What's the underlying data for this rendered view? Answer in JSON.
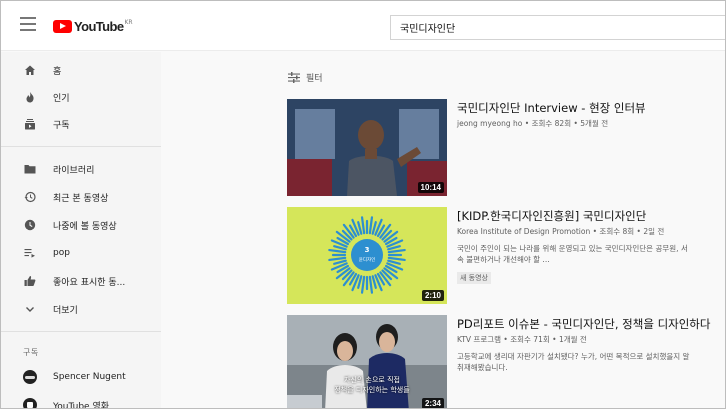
{
  "header": {
    "logo_text": "YouTube",
    "logo_region": "KR",
    "search_value": "국민디자인단"
  },
  "sidebar": {
    "main": [
      {
        "label": "홈",
        "icon": "home-icon"
      },
      {
        "label": "인기",
        "icon": "flame-icon"
      },
      {
        "label": "구독",
        "icon": "subscriptions-icon"
      }
    ],
    "library": [
      {
        "label": "라이브러리",
        "icon": "folder-icon"
      },
      {
        "label": "최근 본 동영상",
        "icon": "history-icon"
      },
      {
        "label": "나중에 볼 동영상",
        "icon": "clock-icon"
      },
      {
        "label": "pop",
        "icon": "playlist-icon"
      },
      {
        "label": "좋아요 표시한 동...",
        "icon": "thumbs-up-icon"
      },
      {
        "label": "더보기",
        "icon": "chevron-down-icon"
      }
    ],
    "subscriptions_title": "구독",
    "subscriptions": [
      {
        "label": "Spencer Nugent",
        "icon": "channel-avatar-icon"
      },
      {
        "label": "YouTube 영화",
        "icon": "youtube-movies-icon"
      }
    ]
  },
  "main": {
    "filter_label": "필터",
    "results": [
      {
        "title": "국민디자인단 Interview - 현장 인터뷰",
        "meta": "jeong myeong ho • 조회수 82회 • 5개월 전",
        "description_lines": [],
        "badge": "",
        "duration": "10:14"
      },
      {
        "title": "[KIDP.한국디자인진흥원] 국민디자인단",
        "meta": "Korea Institute of Design Promotion • 조회수 8회 • 2일 전",
        "description_lines": [
          "국민이 주인이 되는 나라를 위해 운영되고 있는 국민디자인단은 공무원, 서",
          "속 불편하거나 개선해야 할 ..."
        ],
        "badge": "새 동영상",
        "duration": "2:10",
        "thumb_caption": "3 윤디자인"
      },
      {
        "title": "PD리포트 이슈본 - 국민디자인단, 정책을 디자인하다",
        "meta": "KTV 프로그램 • 조회수 71회 • 1개월 전",
        "description_lines": [
          "고등학교에 생리대 자판기가 설치됐다? 누가, 어떤 목적으로 설치했을지 알",
          "취재해봤습니다."
        ],
        "badge": "",
        "duration": "2:34",
        "thumb_caption_lines": [
          "자신의 손으로 직접",
          "정책을 디자인하는 학생들"
        ]
      }
    ]
  },
  "colors": {
    "brand_red": "#ff0000",
    "thumb_yellow": "#d5e65a",
    "ring_blue": "#2d8fd0"
  }
}
